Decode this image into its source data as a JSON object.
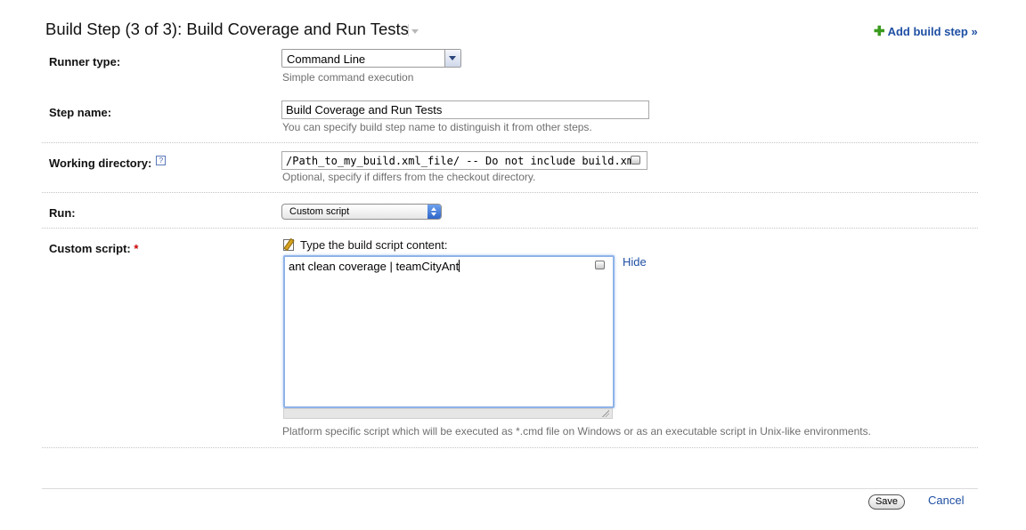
{
  "header": {
    "title": "Build Step (3 of 3): Build Coverage and Run Tests",
    "add_build_step_label": "Add build step »"
  },
  "form": {
    "runner_type": {
      "label": "Runner type:",
      "selected": "Command Line",
      "note": "Simple command execution"
    },
    "step_name": {
      "label": "Step name:",
      "value": "Build Coverage and Run Tests",
      "note": "You can specify build step name to distinguish it from other steps."
    },
    "working_directory": {
      "label": "Working directory:",
      "help": "?",
      "value": "/Path_to_my_build.xml_file/ -- Do not include build.xml",
      "note": "Optional, specify if differs from the checkout directory."
    },
    "run": {
      "label": "Run:",
      "selected": "Custom script"
    },
    "custom_script": {
      "label": "Custom script:",
      "required_mark": "*",
      "caption": "Type the build script content:",
      "value": "ant clean coverage | teamCityAnt",
      "hide_label": "Hide",
      "note": "Platform specific script which will be executed as *.cmd file on Windows or as an executable script in Unix-like environments."
    }
  },
  "footer": {
    "save_label": "Save",
    "cancel_label": "Cancel"
  },
  "colors": {
    "link": "#1f4fa3",
    "add_icon": "#3a9a1d",
    "required": "#cc0000",
    "focus_border": "#8fb3e8"
  },
  "icons": {
    "add": "plus-icon",
    "help": "help-icon",
    "edit": "edit-icon",
    "dropdown": "chevron-down-icon"
  }
}
